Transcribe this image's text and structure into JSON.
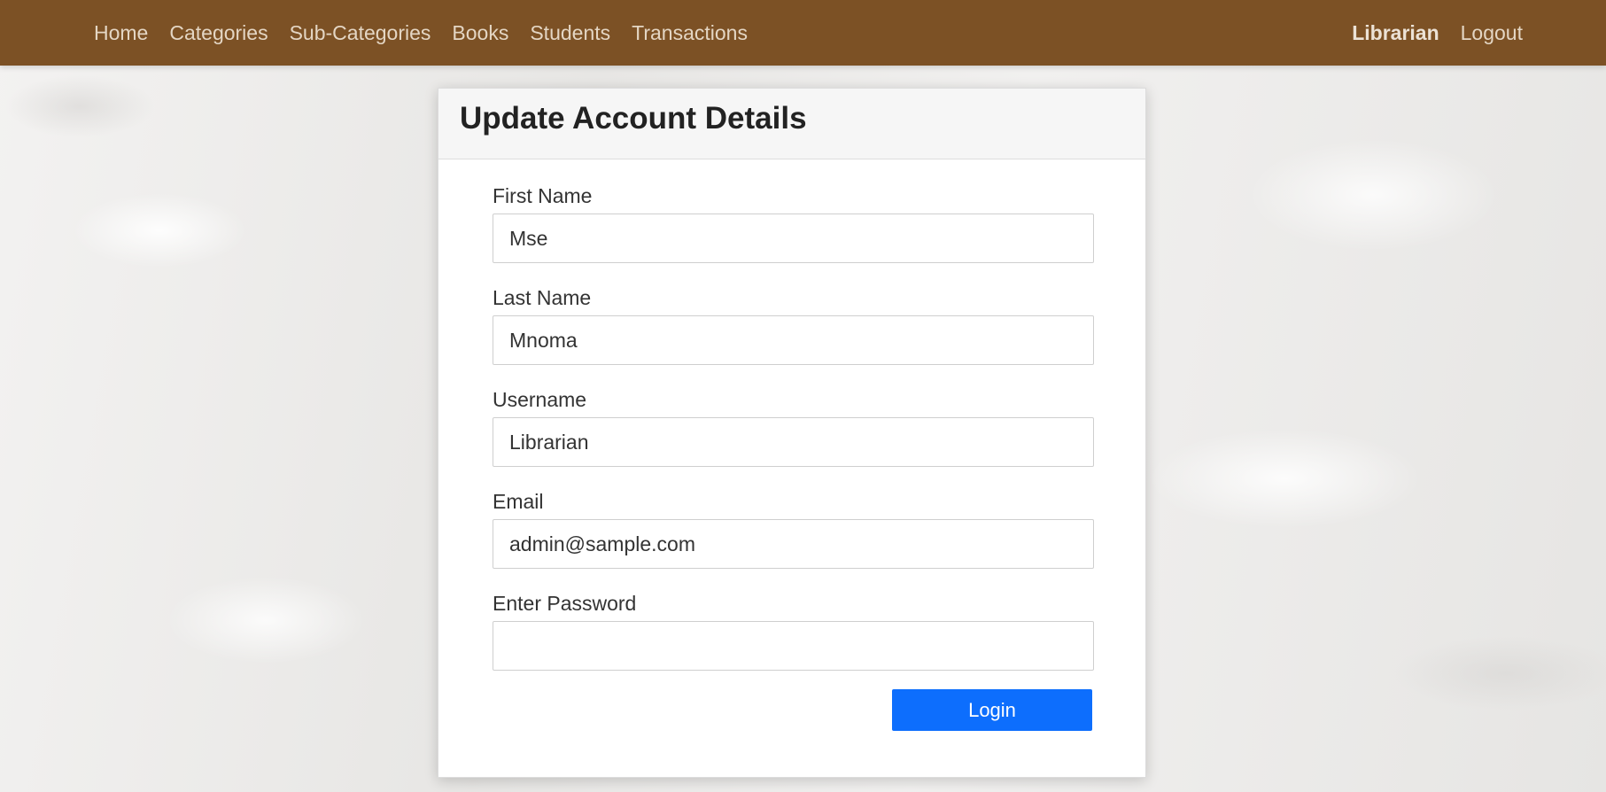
{
  "colors": {
    "navbar_bg": "#7c5125",
    "nav_text": "#e4d6c4",
    "button_primary": "#0d6efd",
    "card_header_bg": "#f6f6f6"
  },
  "navbar": {
    "links": [
      "Home",
      "Categories",
      "Sub-Categories",
      "Books",
      "Students",
      "Transactions"
    ],
    "user": "Librarian",
    "logout": "Logout"
  },
  "form": {
    "title": "Update Account Details",
    "fields": [
      {
        "label": "First Name",
        "value": "Mse",
        "placeholder": ""
      },
      {
        "label": "Last Name",
        "value": "Mnoma",
        "placeholder": ""
      },
      {
        "label": "Username",
        "value": "Librarian",
        "placeholder": ""
      },
      {
        "label": "Email",
        "value": "admin@sample.com",
        "placeholder": ""
      },
      {
        "label": "Enter Password",
        "value": "",
        "placeholder": ""
      }
    ],
    "submit_label": "Login"
  }
}
